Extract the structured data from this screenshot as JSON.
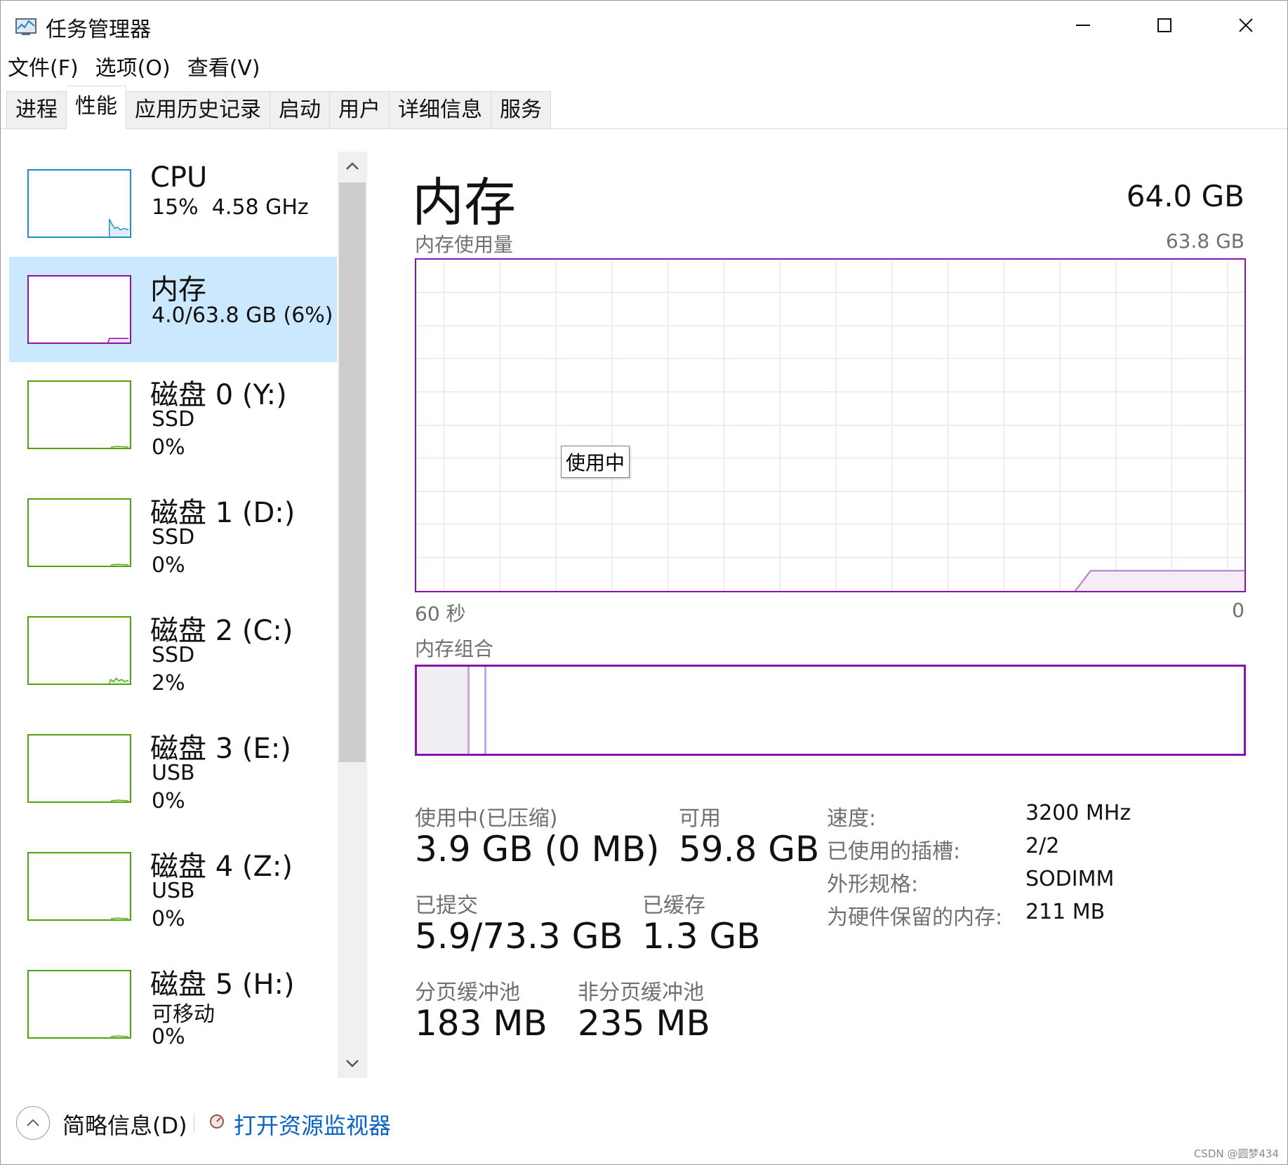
{
  "window": {
    "title": "任务管理器"
  },
  "menu": [
    "文件(F)",
    "选项(O)",
    "查看(V)"
  ],
  "tabs": [
    {
      "label": "进程",
      "active": false
    },
    {
      "label": "性能",
      "active": true
    },
    {
      "label": "应用历史记录",
      "active": false
    },
    {
      "label": "启动",
      "active": false
    },
    {
      "label": "用户",
      "active": false
    },
    {
      "label": "详细信息",
      "active": false
    },
    {
      "label": "服务",
      "active": false
    }
  ],
  "sidebar": {
    "cpu": {
      "title": "CPU",
      "usage": "15%",
      "speed": "4.58 GHz"
    },
    "memory": {
      "title": "内存",
      "summary": "4.0/63.8 GB (6%)"
    },
    "disks": [
      {
        "title": "磁盘 0 (Y:)",
        "type": "SSD",
        "usage": "0%"
      },
      {
        "title": "磁盘 1 (D:)",
        "type": "SSD",
        "usage": "0%"
      },
      {
        "title": "磁盘 2 (C:)",
        "type": "SSD",
        "usage": "2%"
      },
      {
        "title": "磁盘 3 (E:)",
        "type": "USB",
        "usage": "0%"
      },
      {
        "title": "磁盘 4 (Z:)",
        "type": "USB",
        "usage": "0%"
      },
      {
        "title": "磁盘 5 (H:)",
        "type": "可移动",
        "usage": "0%"
      }
    ]
  },
  "main": {
    "title": "内存",
    "total": "64.0 GB",
    "usage_label": "内存使用量",
    "usage_max": "63.8 GB",
    "graph_left": "60 秒",
    "graph_right": "0",
    "tooltip": "使用中",
    "composition_label": "内存组合",
    "composition": {
      "in_use_fraction": 0.061,
      "modified_fraction": 0.018
    },
    "stats": {
      "in_use_label": "使用中(已压缩)",
      "in_use_value": "3.9 GB (0 MB)",
      "available_label": "可用",
      "available_value": "59.8 GB",
      "committed_label": "已提交",
      "committed_value": "5.9/73.3 GB",
      "cached_label": "已缓存",
      "cached_value": "1.3 GB",
      "paged_label": "分页缓冲池",
      "paged_value": "183 MB",
      "nonpaged_label": "非分页缓冲池",
      "nonpaged_value": "235 MB"
    },
    "details": [
      {
        "label": "速度:",
        "value": "3200 MHz"
      },
      {
        "label": "已使用的插槽:",
        "value": "2/2"
      },
      {
        "label": "外形规格:",
        "value": "SODIMM"
      },
      {
        "label": "为硬件保留的内存:",
        "value": "211 MB"
      }
    ]
  },
  "footer": {
    "fewer_details": "简略信息(D)",
    "open_resmon": "打开资源监视器"
  },
  "watermark": "CSDN @圆梦434",
  "colors": {
    "memory": "#8b12ae",
    "cpu": "#1e90c8",
    "disk": "#4da60c",
    "selected": "#cce8ff",
    "link": "#0a62c7"
  }
}
